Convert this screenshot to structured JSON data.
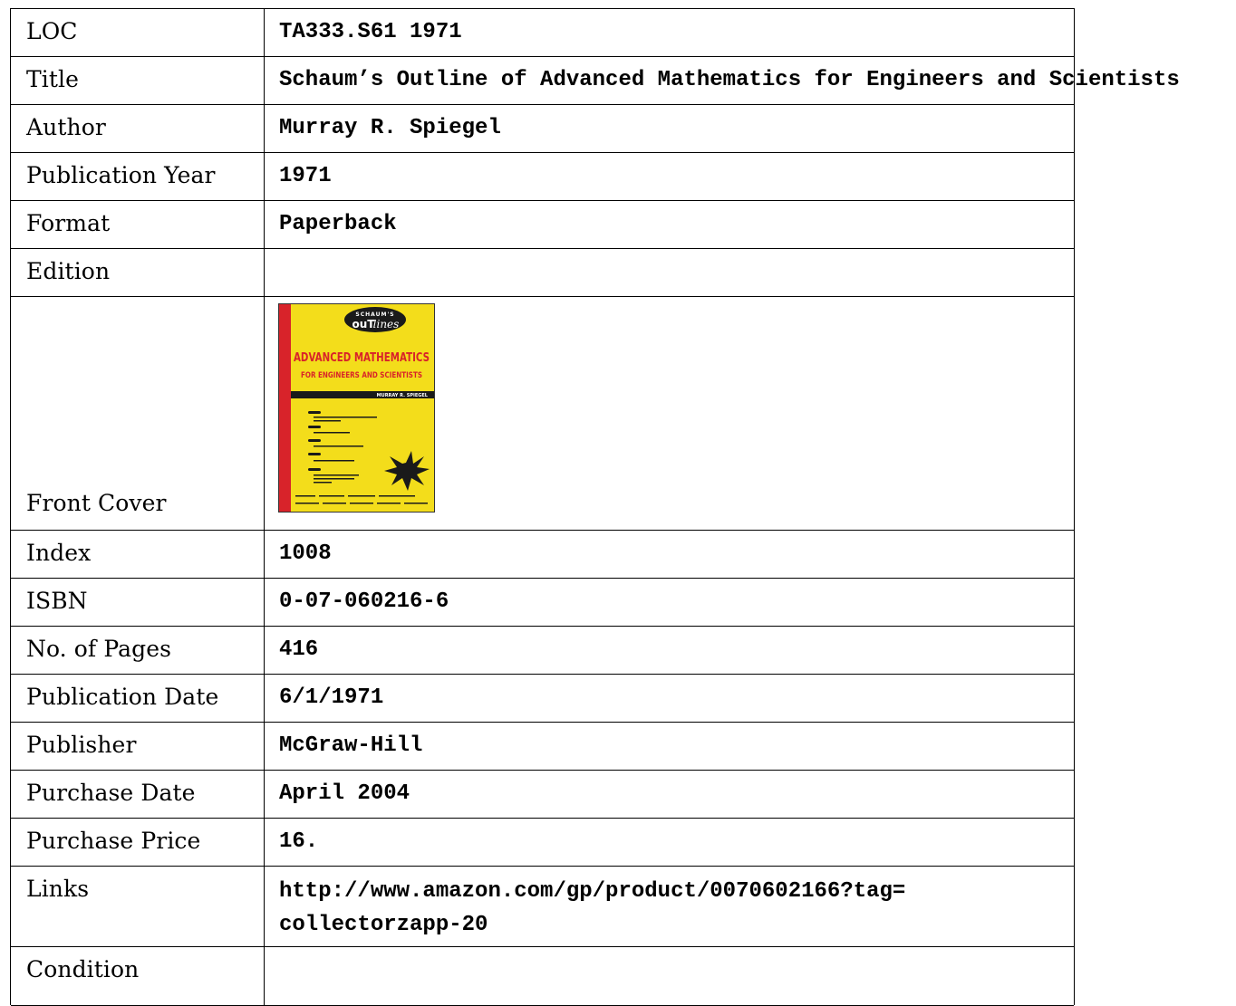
{
  "rows": [
    {
      "label": "LOC",
      "value": "TA333.S61 1971"
    },
    {
      "label": "Title",
      "value": "Schaum’s Outline of Advanced Mathematics for Engineers and Scientists"
    },
    {
      "label": "Author",
      "value": "Murray R. Spiegel"
    },
    {
      "label": "Publication Year",
      "value": "1971"
    },
    {
      "label": "Format",
      "value": "Paperback"
    },
    {
      "label": "Edition",
      "value": ""
    },
    {
      "label": "Front Cover",
      "value": ""
    },
    {
      "label": "Index",
      "value": "1008"
    },
    {
      "label": "ISBN",
      "value": "0-07-060216-6"
    },
    {
      "label": "No. of Pages",
      "value": "416"
    },
    {
      "label": "Publication Date",
      "value": "6/1/1971"
    },
    {
      "label": "Publisher",
      "value": "McGraw-Hill"
    },
    {
      "label": "Purchase Date",
      "value": "April 2004"
    },
    {
      "label": "Purchase Price",
      "value": "16."
    },
    {
      "label": "Links",
      "value_line1": "http://www.amazon.com/gp/product/0070602166?tag=",
      "value_line2": "collectorzapp-20"
    },
    {
      "label": "Condition",
      "value": ""
    }
  ],
  "cover": {
    "series_top": "SCHAUM'S",
    "series_logo_a": "ouT",
    "series_logo_b": "lines",
    "title_line1": "ADVANCED MATHEMATICS",
    "title_line2": "FOR ENGINEERS AND SCIENTISTS",
    "author": "MURRAY R. SPIEGEL",
    "colors": {
      "spine": "#d8232a",
      "background": "#f3dd1b",
      "title": "#d8232a",
      "band": "#1a1a1a"
    }
  }
}
